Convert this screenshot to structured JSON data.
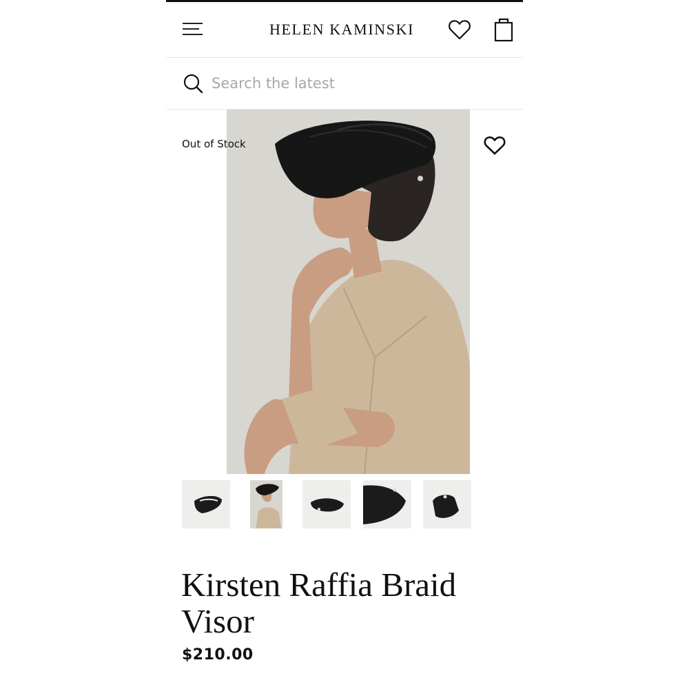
{
  "header": {
    "brand": "HELEN KAMINSKI",
    "menu_icon": "hamburger-menu-icon",
    "wishlist_icon": "heart-icon",
    "bag_icon": "shopping-bag-icon"
  },
  "search": {
    "placeholder": "Search the latest",
    "icon": "search-icon"
  },
  "product": {
    "stock_status": "Out of Stock",
    "title": "Kirsten Raffia Braid Visor",
    "price": "$210.00",
    "thumbnail_count": 5
  },
  "colors": {
    "text": "#111111",
    "placeholder": "#a7a7a7",
    "divider": "#e6e6e6",
    "hat": "#161616",
    "jacket": "#cdb79b",
    "backdrop": "#d8d6d1"
  }
}
